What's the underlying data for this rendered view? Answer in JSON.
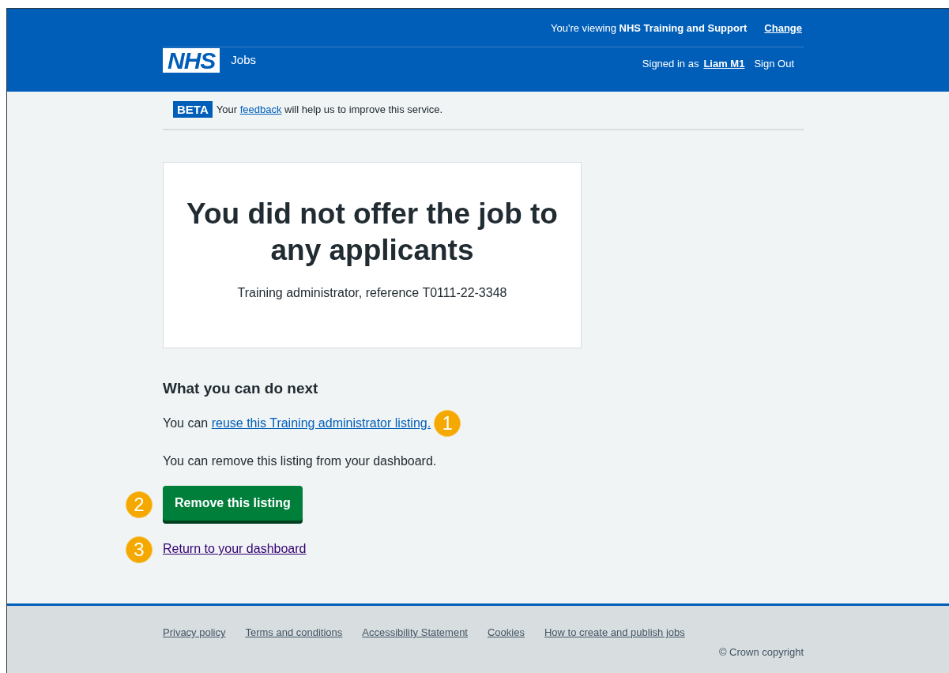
{
  "header": {
    "logo": "NHS",
    "service": "Jobs",
    "viewing_prefix": "You're viewing",
    "organisation": "NHS Training and Support",
    "change_link": "Change",
    "signed_in_prefix": "Signed in as",
    "user_link": "Liam M1",
    "sign_out": "Sign Out"
  },
  "beta_banner": {
    "tag": "BETA",
    "text_before": "Your",
    "link": "feedback",
    "text_after": "will help us to improve this service."
  },
  "panel": {
    "title": "You did not offer the job to any applicants",
    "subtitle": "Training administrator, reference T0111-22-3348"
  },
  "next_steps": {
    "heading": "What you can do next",
    "reuse_prefix": "You can",
    "reuse_link": "reuse this Training administrator listing.",
    "reuse_callout": "1",
    "remove_text": "You can remove this listing from your dashboard.",
    "remove_button": "Remove this listing",
    "remove_callout": "2",
    "return_link": "Return to your dashboard",
    "return_callout": "3"
  },
  "footer": {
    "links": [
      "Privacy policy",
      "Terms and conditions",
      "Accessibility Statement",
      "Cookies",
      "How to create and publish jobs"
    ],
    "copyright": "© Crown copyright"
  }
}
